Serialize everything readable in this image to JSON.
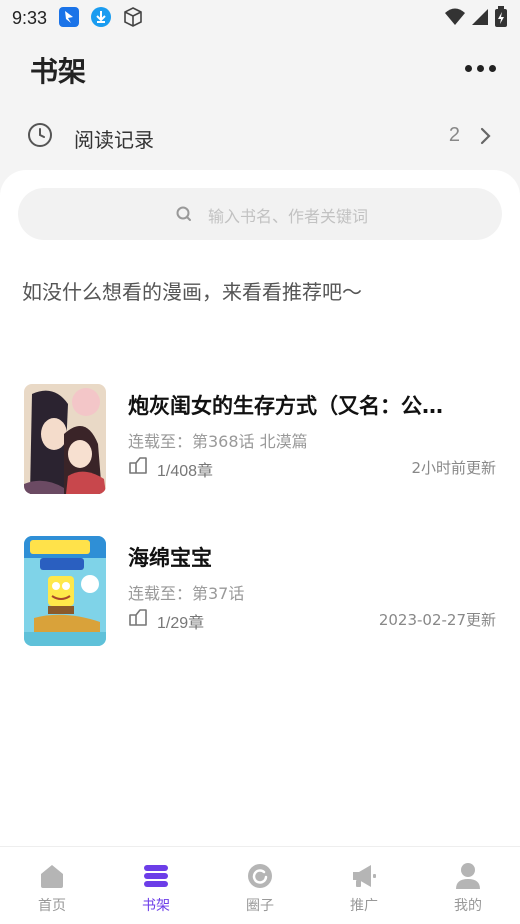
{
  "status_bar": {
    "time": "9:33"
  },
  "header": {
    "title": "书架"
  },
  "history": {
    "label": "阅读记录",
    "count": "2"
  },
  "search": {
    "placeholder": "输入书名、作者关键词"
  },
  "recommend_text": "如没什么想看的漫画，来看看推荐吧～",
  "books": [
    {
      "title": "炮灰闺女的生存方式（又名：公…",
      "serial": "连载至：第368话 北漠篇",
      "progress": "1/408章",
      "updated": "2小时前更新"
    },
    {
      "title": "海绵宝宝",
      "serial": "连载至：第37话",
      "progress": "1/29章",
      "updated": "2023-02-27更新"
    }
  ],
  "nav": [
    {
      "label": "首页",
      "icon": "home-icon"
    },
    {
      "label": "书架",
      "icon": "bookshelf-icon"
    },
    {
      "label": "圈子",
      "icon": "circle-icon"
    },
    {
      "label": "推广",
      "icon": "megaphone-icon"
    },
    {
      "label": "我的",
      "icon": "user-icon"
    }
  ],
  "colors": {
    "accent": "#6c3de8",
    "inactive": "#999999",
    "background": "#f4f4f4"
  }
}
